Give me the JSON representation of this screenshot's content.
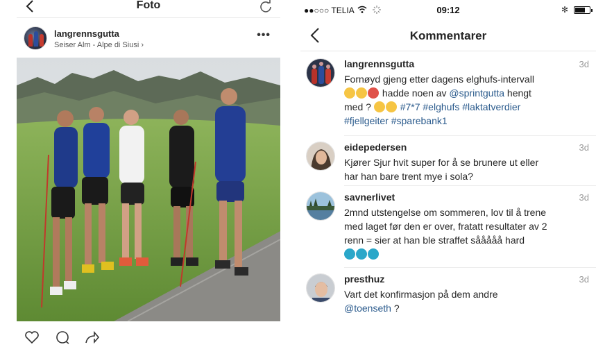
{
  "left_panel": {
    "nav": {
      "title": "Foto"
    },
    "post": {
      "username": "langrennsgutta",
      "location": "Seiser Alm - Alpe di Siusi",
      "location_chevron": "›",
      "more": "•••"
    },
    "actions": [
      "heart-icon",
      "comment-icon",
      "share-icon"
    ]
  },
  "right_panel": {
    "status_bar": {
      "carrier": "●●○○○ TELIA",
      "wifi": "wifi-icon",
      "time": "09:12",
      "bluetooth": "✻"
    },
    "nav": {
      "title": "Kommentarer"
    },
    "comments": [
      {
        "username": "langrennsgutta",
        "age": "3d",
        "line1": "Fornøyd gjeng etter dagens elghufs-intervall",
        "line2_text": "hadde noen av",
        "line2_mention": "@sprintgutta",
        "line2_end": "hengt",
        "line3_start": "med ?",
        "line3_tags": "#7*7 #elghufs #laktatverdier",
        "line4_tags": "#fjellgeiter #sparebank1"
      },
      {
        "username": "eidepedersen",
        "age": "3d",
        "line1": "Kjører Sjur hvit super for å se brunere ut eller",
        "line2": "har han bare trent mye i sola?"
      },
      {
        "username": "savnerlivet",
        "age": "3d",
        "line1": "2mnd utstengelse om sommeren, lov til å trene",
        "line2": "med laget før den er over, fratatt resultater av 2",
        "line3": "renn = sier at han ble straffet sååååå hard"
      },
      {
        "username": "presthuz",
        "age": "3d",
        "line1": "Vart det konfirmasjon på dem andre",
        "line2_mention": "@toenseth",
        "line2_end": "?"
      }
    ]
  },
  "colors": {
    "text": "#262626",
    "link": "#2a5a8c",
    "muted": "#999999",
    "divider": "#ececec"
  }
}
